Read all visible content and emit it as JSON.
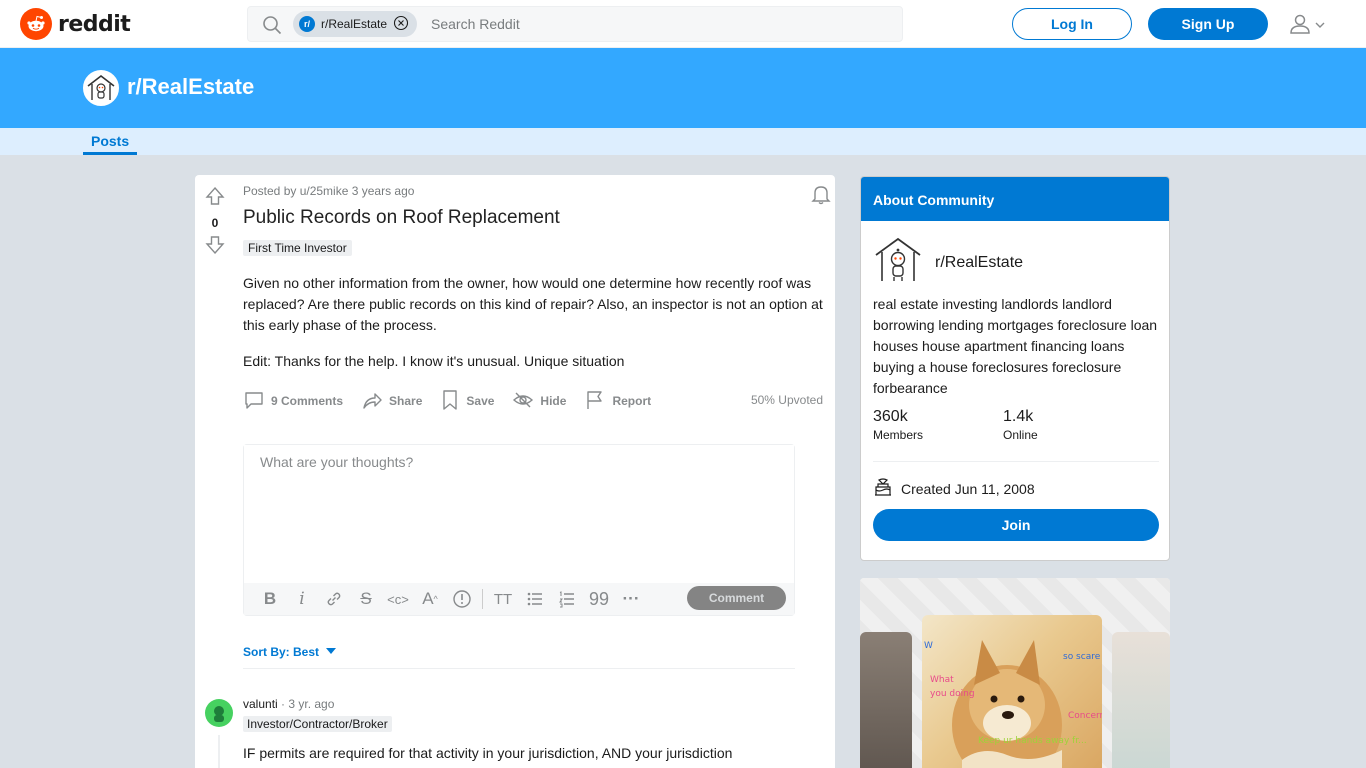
{
  "header": {
    "logo_text": "reddit",
    "search_chip": "r/RealEstate",
    "search_placeholder": "Search Reddit",
    "login_label": "Log In",
    "signup_label": "Sign Up"
  },
  "banner": {
    "subreddit": "r/RealEstate",
    "tab_posts": "Posts"
  },
  "post": {
    "votes": "0",
    "meta": "Posted by u/25mike 3 years ago",
    "title": "Public Records on Roof Replacement",
    "flair": "First Time Investor",
    "body_p1": "Given no other information from the owner, how would one determine how recently roof was replaced? Are there public records on this kind of repair? Also, an inspector is not an option at this early phase of the process.",
    "body_p2": "Edit: Thanks for the help. I know it's unusual. Unique situation",
    "actions": {
      "comments": "9 Comments",
      "share": "Share",
      "save": "Save",
      "hide": "Hide",
      "report": "Report"
    },
    "upvoted": "50% Upvoted"
  },
  "comment_box": {
    "placeholder": "What are your thoughts?",
    "submit_label": "Comment"
  },
  "sort": {
    "label": "Sort By: Best"
  },
  "first_comment": {
    "user": "valunti",
    "time": "3 yr. ago",
    "flair": "Investor/Contractor/Broker",
    "text": "IF permits are required for that activity in your jurisdiction, AND your jurisdiction"
  },
  "sidebar": {
    "about_title": "About Community",
    "subreddit": "r/RealEstate",
    "description": "real estate investing landlords landlord borrowing lending mortgages foreclosure loan houses house apartment financing loans buying a house foreclosures foreclosure forbearance",
    "members_count": "360k",
    "members_label": "Members",
    "online_count": "1.4k",
    "online_label": "Online",
    "created": "Created Jun 11, 2008",
    "join_label": "Join"
  },
  "promo": {
    "caption_1": "W",
    "caption_2": "so scare",
    "caption_3": "What",
    "caption_4": "you doing",
    "caption_5": "Concern",
    "caption_6": "Keep ur hands away fr..."
  },
  "colors": {
    "brand": "#ff4500",
    "accent": "#0079d3",
    "banner": "#33a8ff"
  }
}
